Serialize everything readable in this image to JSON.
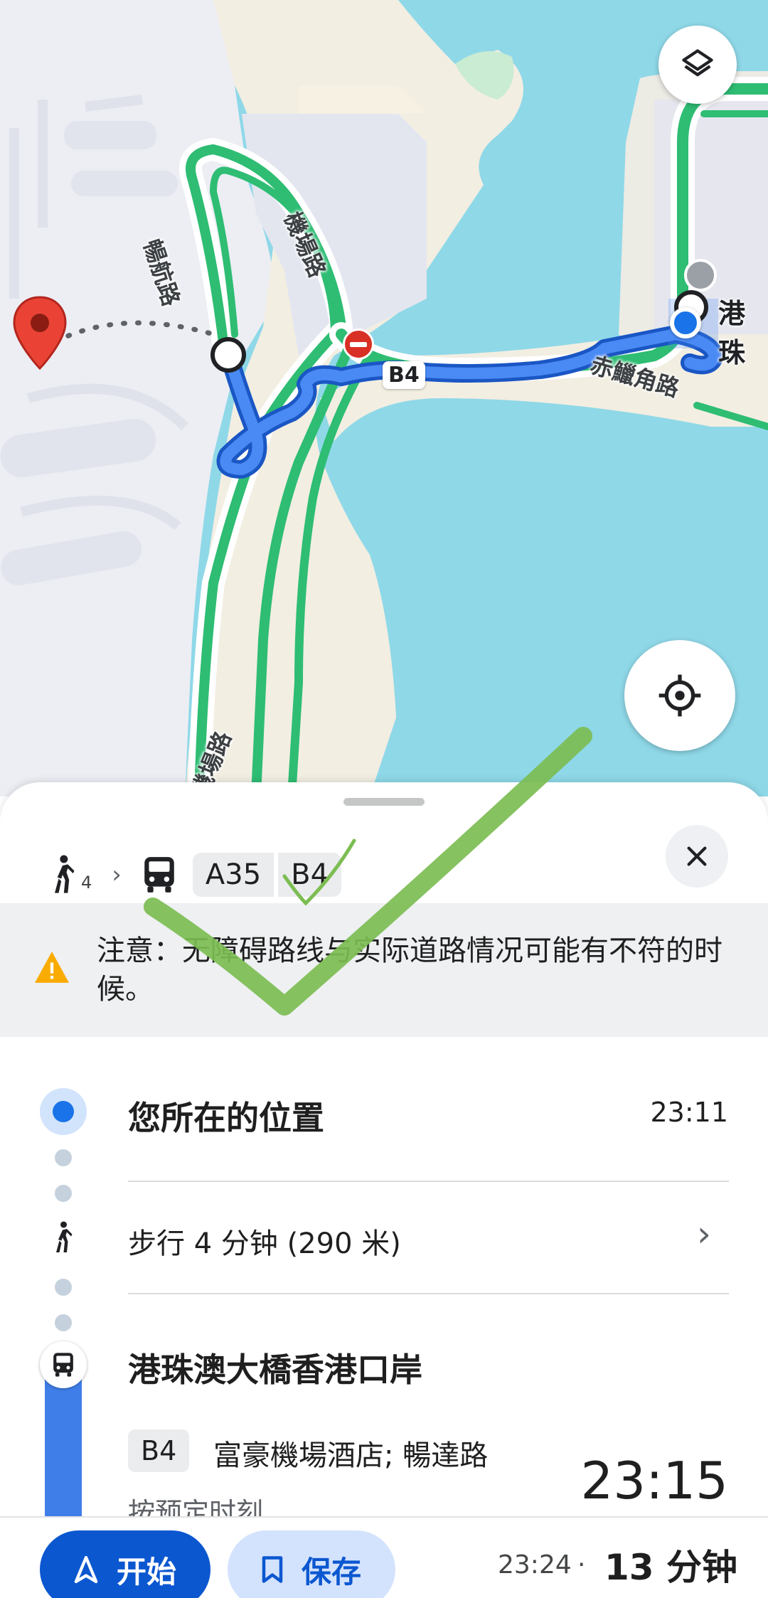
{
  "map": {
    "road_labels": [
      "暢航路",
      "機場路",
      "機場路",
      "赤鱲角路"
    ],
    "route_badge": "B4",
    "place_label": "港珠",
    "layers_icon": "layers-icon",
    "locate_icon": "my-location-icon"
  },
  "sheet": {
    "summary": {
      "walk_minutes": "4",
      "lines": [
        "A35",
        "B4"
      ]
    },
    "notice": {
      "text": "注意：无障碍路线与实际道路情况可能有不符的时候。"
    },
    "start": {
      "title": "您所在的位置",
      "time": "23:11"
    },
    "walk": {
      "text": "步行 4 分钟 (290 米)"
    },
    "stop": {
      "title": "港珠澳大橋香港口岸",
      "line": "B4",
      "stop_names": "富豪機場酒店; 暢達路",
      "departure": "23:15",
      "schedule": "按预定时刻"
    }
  },
  "bottom_bar": {
    "start_label": "开始",
    "save_label": "保存",
    "arrival_time": "23:24",
    "separator": "·",
    "duration": "13 分钟"
  },
  "colors": {
    "route_blue": "#3f7ee8",
    "traffic_green": "#2ebd73",
    "water": "#8fd8e8",
    "primary": "#0b57d0",
    "warning": "#f9ab00"
  }
}
